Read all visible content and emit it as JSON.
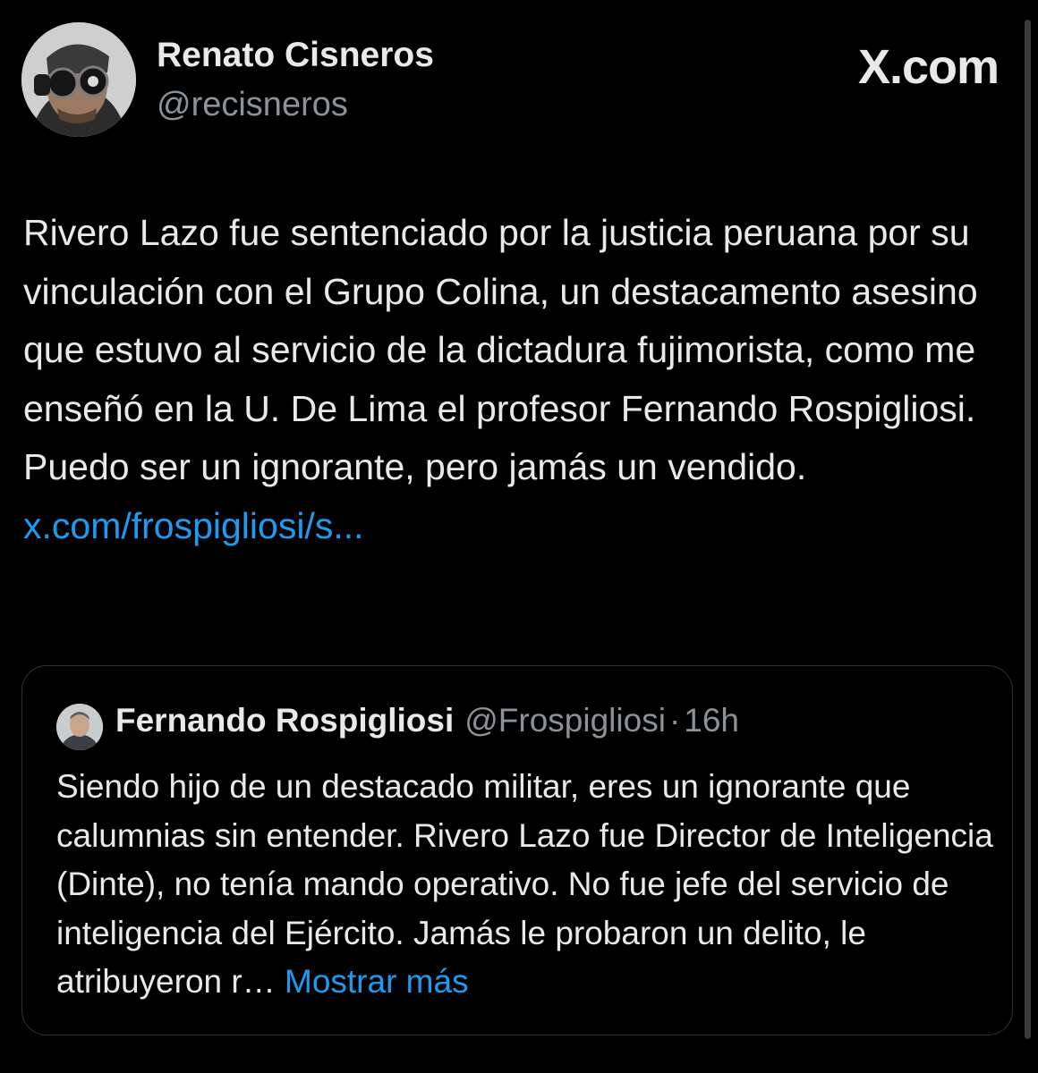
{
  "author": {
    "name": "Renato Cisneros",
    "handle": "@recisneros"
  },
  "source_logo": "X.com",
  "tweet": {
    "text": "Rivero Lazo fue sentenciado por la justicia peruana por su vinculación con el Grupo Colina, un destacamento asesino que estuvo al servicio de la dictadura fujimorista, como me enseñó en la U. De Lima el profesor Fernando Rospigliosi. Puedo ser un ignorante, pero jamás un vendido.",
    "link": "x.com/frospigliosi/s..."
  },
  "quoted": {
    "name": "Fernando Rospigliosi",
    "handle": "@Frospigliosi",
    "separator": "·",
    "time": "16h",
    "text": "Siendo hijo de un destacado militar, eres un ignorante que calumnias sin entender. Rivero Lazo fue Director de Inteligencia (Dinte), no tenía mando operativo. No fue jefe del servicio de inteligencia del Ejército. Jamás le probaron un delito, le atribuyeron r…",
    "show_more": "Mostrar más"
  },
  "colors": {
    "background": "#000000",
    "text": "#e7e9ea",
    "secondary": "#8b9298",
    "link": "#1d9bf0",
    "border": "#2f3336"
  }
}
